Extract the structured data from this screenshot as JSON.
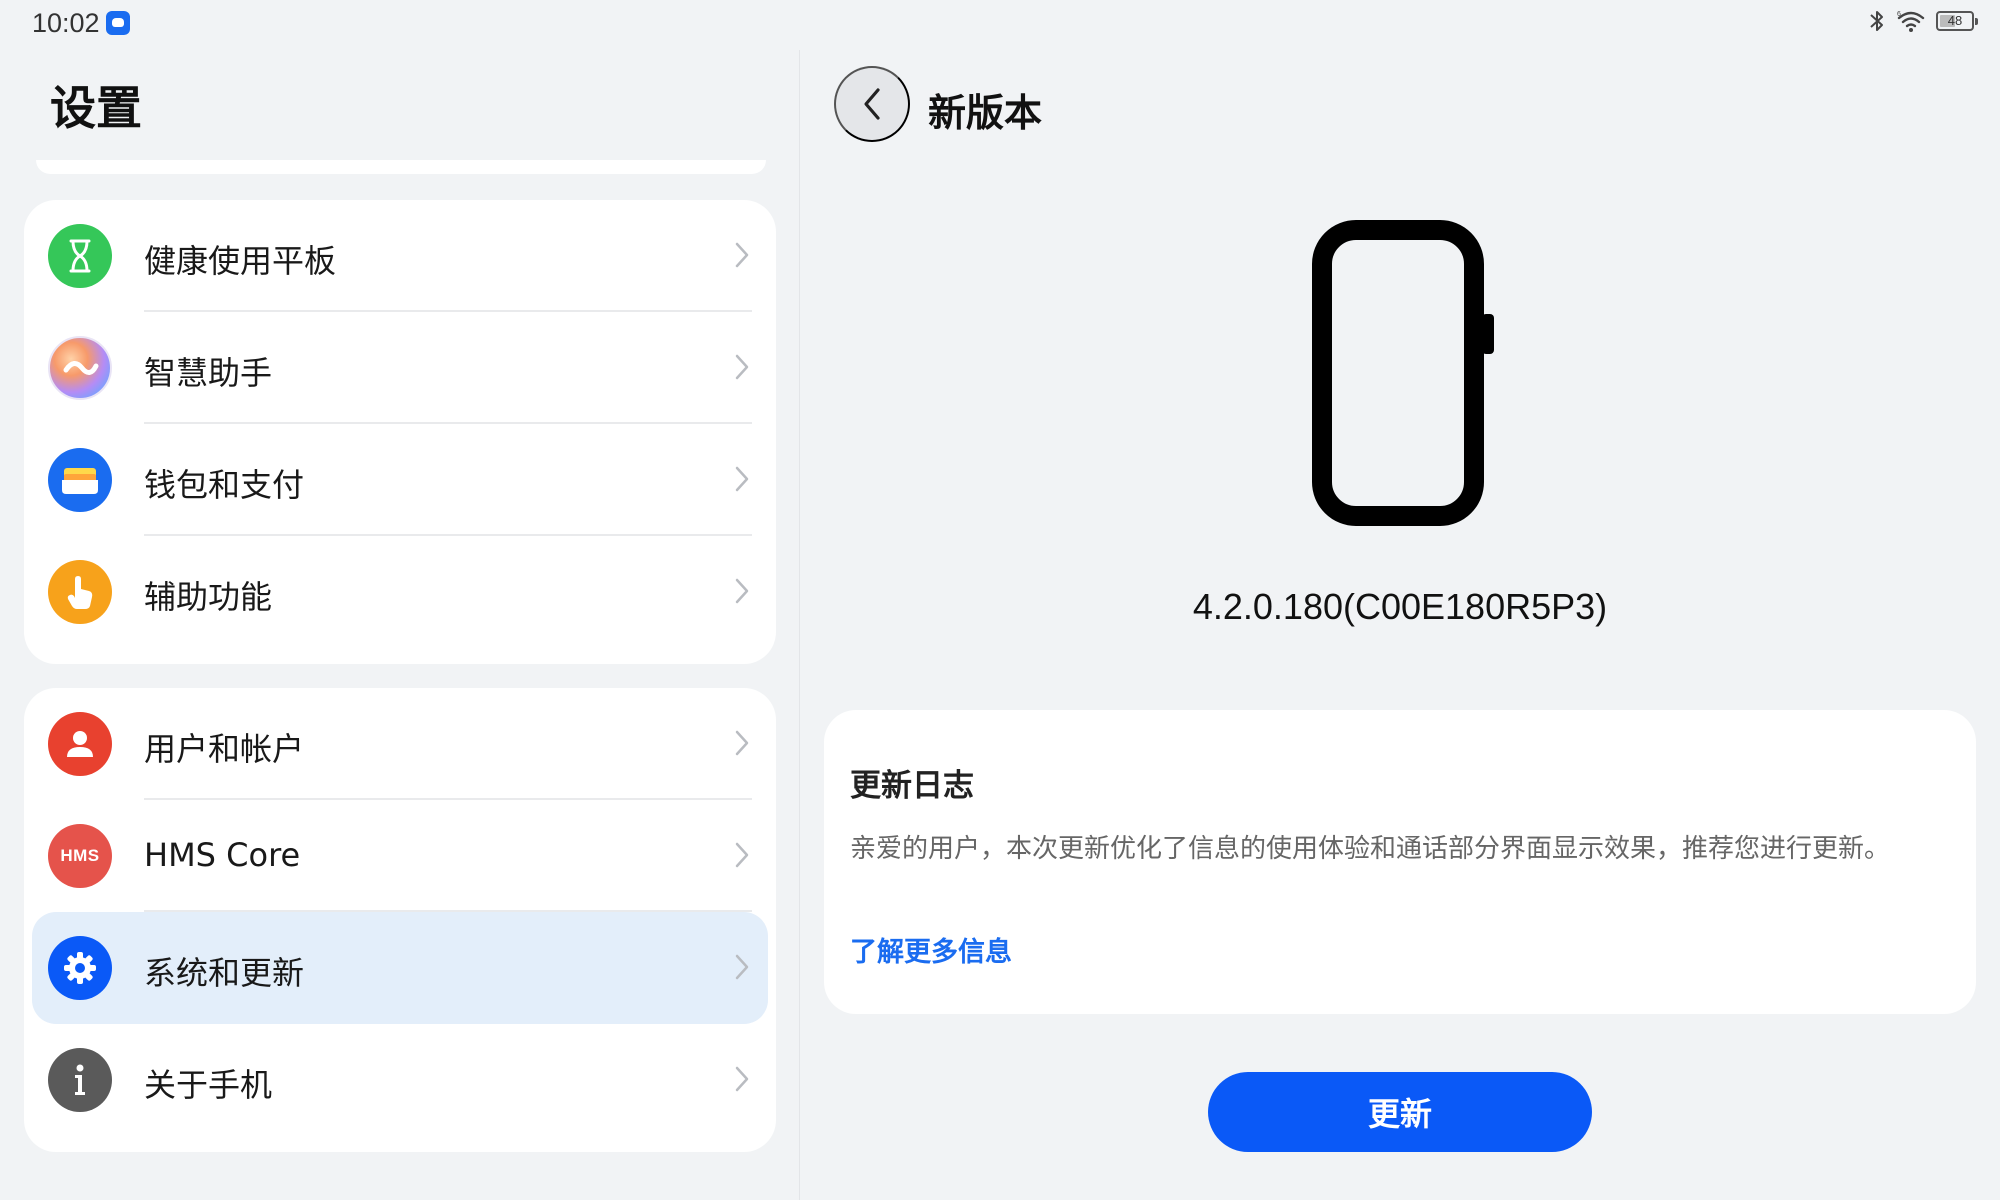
{
  "status_bar": {
    "time": "10:02",
    "battery_level": "48",
    "icons": [
      "bluetooth-icon",
      "wifi-icon",
      "battery-icon"
    ]
  },
  "left_pane": {
    "title": "设置",
    "groups": [
      {
        "items": [
          {
            "label": "健康使用平板",
            "icon": "hourglass-icon",
            "icon_color": "#35c759"
          },
          {
            "label": "智慧助手",
            "icon": "assistant-icon",
            "icon_color": "#9a7bf5"
          },
          {
            "label": "钱包和支付",
            "icon": "wallet-icon",
            "icon_color": "#1a6cf0"
          },
          {
            "label": "辅助功能",
            "icon": "hand-pointer-icon",
            "icon_color": "#f7a21b"
          }
        ]
      },
      {
        "items": [
          {
            "label": "用户和帐户",
            "icon": "user-icon",
            "icon_color": "#e8412f"
          },
          {
            "label": "HMS Core",
            "icon": "hms-icon",
            "icon_text": "HMS",
            "icon_color": "#e5534b"
          },
          {
            "label": "系统和更新",
            "icon": "gear-icon",
            "icon_color": "#0a59f7",
            "selected": true
          },
          {
            "label": "关于手机",
            "icon": "info-icon",
            "icon_color": "#5a5a5a"
          }
        ]
      }
    ]
  },
  "right_pane": {
    "title": "新版本",
    "version": "4.2.0.180(C00E180R5P3)",
    "changelog": {
      "title": "更新日志",
      "body": "亲爱的用户，本次更新优化了信息的使用体验和通话部分界面显示效果，推荐您进行更新。",
      "link": "了解更多信息"
    },
    "update_button": "更新"
  },
  "colors": {
    "background": "#f1f3f5",
    "card": "#ffffff",
    "accent": "#0a59f7",
    "selected_row": "#e3eefa",
    "link": "#1a6cf0"
  }
}
